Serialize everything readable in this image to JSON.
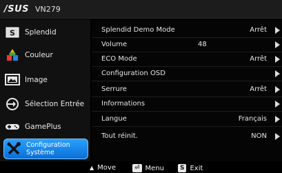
{
  "header": {
    "brand": "/SUS",
    "model": "VN279"
  },
  "sidebar": {
    "items": [
      {
        "label": "Splendid",
        "icon": "splendid-s-icon"
      },
      {
        "label": "Couleur",
        "icon": "color-blocks-icon"
      },
      {
        "label": "Image",
        "icon": "image-monitor-icon"
      },
      {
        "label": "Sélection Entrée",
        "icon": "input-arrow-icon"
      },
      {
        "label": "GamePlus",
        "icon": "gamepad-icon"
      },
      {
        "label": "Configuration Système",
        "icon": "tools-icon",
        "selected": true
      }
    ],
    "accent": "#1a8cf0"
  },
  "menu": {
    "rows": [
      {
        "label": "Splendid Demo Mode",
        "mid": "",
        "value": "Arrêt"
      },
      {
        "label": "Volume",
        "mid": "48",
        "value": ""
      },
      {
        "label": "ECO Mode",
        "mid": "",
        "value": "Arrêt"
      },
      {
        "label": "Configuration OSD",
        "mid": "",
        "value": ""
      },
      {
        "label": "Serrure",
        "mid": "",
        "value": "Arrêt"
      },
      {
        "label": "Informations",
        "mid": "",
        "value": ""
      },
      {
        "label": "Langue",
        "mid": "",
        "value": "Français"
      },
      {
        "label": "Tout réinit.",
        "mid": "",
        "value": "NON"
      }
    ]
  },
  "footer": {
    "move": "Move",
    "menu": "Menu",
    "menu_key": "⏎",
    "exit": "Exit",
    "exit_key": "S"
  }
}
